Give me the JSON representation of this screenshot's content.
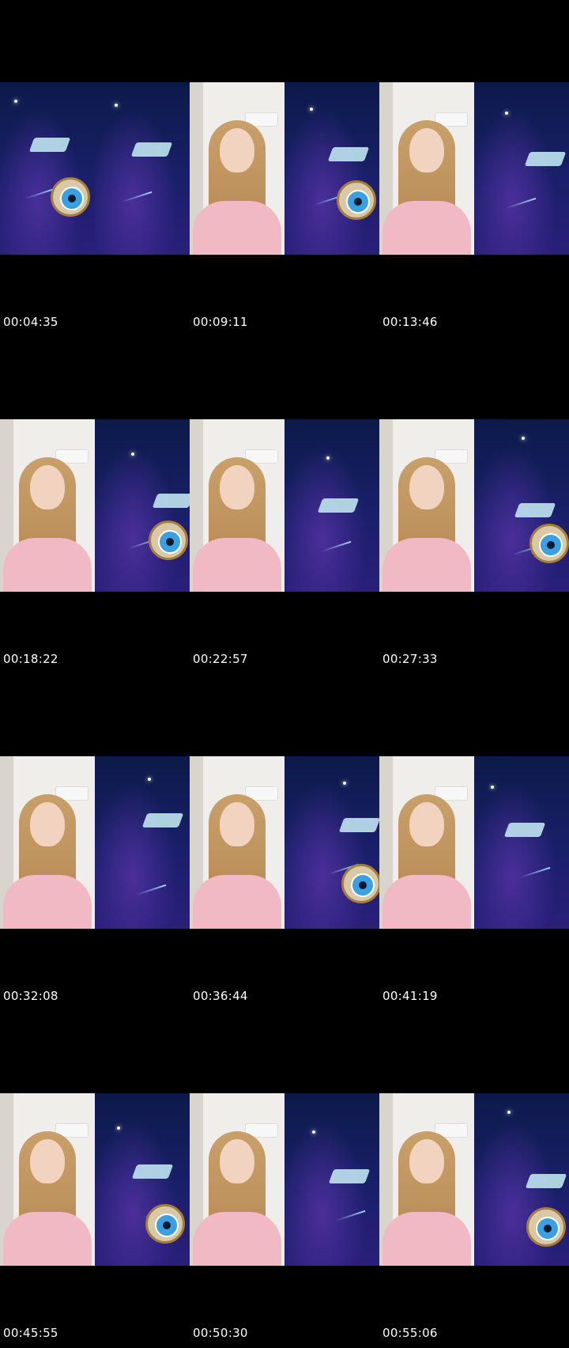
{
  "contact_sheet": {
    "rows": [
      {
        "cells": [
          {
            "timestamp": "00:04:35",
            "left": "space",
            "right": "space"
          },
          {
            "timestamp": "00:09:11",
            "left": "room",
            "right": "space"
          },
          {
            "timestamp": "00:13:46",
            "left": "room",
            "right": "space"
          }
        ]
      },
      {
        "cells": [
          {
            "timestamp": "00:18:22",
            "left": "room",
            "right": "space"
          },
          {
            "timestamp": "00:22:57",
            "left": "room",
            "right": "space"
          },
          {
            "timestamp": "00:27:33",
            "left": "room",
            "right": "space"
          }
        ]
      },
      {
        "cells": [
          {
            "timestamp": "00:32:08",
            "left": "room",
            "right": "space"
          },
          {
            "timestamp": "00:36:44",
            "left": "room",
            "right": "space"
          },
          {
            "timestamp": "00:41:19",
            "left": "room",
            "right": "space"
          }
        ]
      },
      {
        "cells": [
          {
            "timestamp": "00:45:55",
            "left": "room",
            "right": "space"
          },
          {
            "timestamp": "00:50:30",
            "left": "room",
            "right": "space"
          },
          {
            "timestamp": "00:55:06",
            "left": "room",
            "right": "space"
          }
        ]
      }
    ]
  }
}
